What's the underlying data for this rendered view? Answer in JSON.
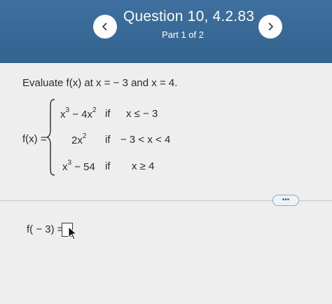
{
  "header": {
    "title": "Question 10, 4.2.83",
    "part": "Part 1 of 2",
    "prev_icon": "chevron-left-icon",
    "next_icon": "chevron-right-icon"
  },
  "prompt": "Evaluate f(x) at x = − 3 and x = 4.",
  "function": {
    "label": "f(x) =",
    "cases": [
      {
        "expr_base": "x",
        "expr_sup": "3",
        "expr_mid": " − 4x",
        "expr_sup2": "2",
        "cond_if": "if",
        "cond": "x ≤ − 3"
      },
      {
        "expr_base": "2x",
        "expr_sup": "2",
        "expr_mid": "",
        "expr_sup2": "",
        "cond_if": "if",
        "cond": "− 3 < x < 4"
      },
      {
        "expr_base": "x",
        "expr_sup": "3",
        "expr_mid": " − 54",
        "expr_sup2": "",
        "cond_if": "if",
        "cond": "x ≥ 4"
      }
    ]
  },
  "more_button": "•••",
  "answer": {
    "label": "f( − 3) =",
    "value": ""
  },
  "colors": {
    "header_bg": "#3f6f9e",
    "content_bg": "#efeeee"
  }
}
